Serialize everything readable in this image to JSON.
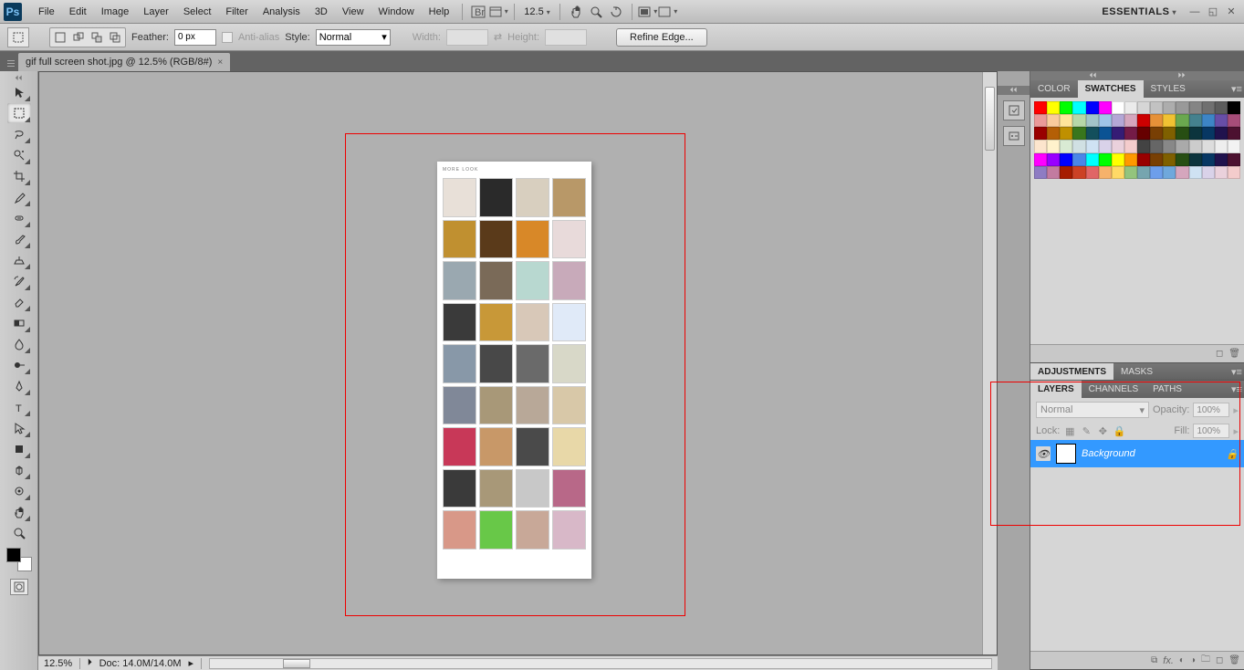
{
  "menubar": {
    "items": [
      "File",
      "Edit",
      "Image",
      "Layer",
      "Select",
      "Filter",
      "Analysis",
      "3D",
      "View",
      "Window",
      "Help"
    ],
    "zoom": "12.5",
    "workspace": "ESSENTIALS"
  },
  "optbar": {
    "feather_label": "Feather:",
    "feather_value": "0 px",
    "antialias": "Anti-alias",
    "style_label": "Style:",
    "style_value": "Normal",
    "width_label": "Width:",
    "height_label": "Height:",
    "refine": "Refine Edge..."
  },
  "doctab": {
    "title": "gif full screen shot.jpg @ 12.5% (RGB/8#)"
  },
  "canvas": {
    "title": "MORE LOOK",
    "foot": ""
  },
  "panels": {
    "color_tabs": [
      "COLOR",
      "SWATCHES",
      "STYLES"
    ],
    "adjust_tabs": [
      "ADJUSTMENTS",
      "MASKS"
    ],
    "layers_tabs": [
      "LAYERS",
      "CHANNELS",
      "PATHS"
    ],
    "layer_mode": "Normal",
    "opacity_label": "Opacity:",
    "opacity_value": "100%",
    "lock_label": "Lock:",
    "fill_label": "Fill:",
    "fill_value": "100%",
    "layer_name": "Background"
  },
  "status": {
    "zoom": "12.5%",
    "doc": "Doc: 14.0M/14.0M"
  },
  "swatches": [
    "#ff0000",
    "#ffff00",
    "#00ff00",
    "#00ffff",
    "#0000ff",
    "#ff00ff",
    "#ffffff",
    "#ebebeb",
    "#d6d6d6",
    "#c2c2c2",
    "#adadad",
    "#999999",
    "#858585",
    "#707070",
    "#5c5c5c",
    "#000000",
    "#ea9999",
    "#f9cb9c",
    "#ffe599",
    "#b6d7a8",
    "#a2c4c9",
    "#9fc5e8",
    "#b4a7d6",
    "#d5a6bd",
    "#cc0000",
    "#e69138",
    "#f1c232",
    "#6aa84f",
    "#45818e",
    "#3d85c6",
    "#674ea7",
    "#a64d79",
    "#990000",
    "#b45f06",
    "#bf9000",
    "#38761d",
    "#134f5c",
    "#0b5394",
    "#351c75",
    "#741b47",
    "#660000",
    "#783f04",
    "#7f6000",
    "#274e13",
    "#0c343d",
    "#073763",
    "#20124d",
    "#4c1130",
    "#fce5cd",
    "#fff2cc",
    "#d9ead3",
    "#d0e0e3",
    "#cfe2f3",
    "#d9d2e9",
    "#ead1dc",
    "#f4cccc",
    "#434343",
    "#666666",
    "#888888",
    "#aaaaaa",
    "#cccccc",
    "#dddddd",
    "#eeeeee",
    "#f3f3f3",
    "#ff00ff",
    "#9900ff",
    "#0000ff",
    "#4a86e8",
    "#00ffff",
    "#00ff00",
    "#ffff00",
    "#ff9900",
    "#980000",
    "#783f04",
    "#7f6000",
    "#274e13",
    "#0c343d",
    "#073763",
    "#20124d",
    "#4c1130",
    "#8e7cc3",
    "#c27ba0",
    "#a61c00",
    "#cc4125",
    "#e06666",
    "#f6b26b",
    "#ffd966",
    "#93c47d",
    "#76a5af",
    "#6d9eeb",
    "#6fa8dc",
    "#d5a6bd",
    "#cfe2f3",
    "#d9d2e9",
    "#ead1dc",
    "#f4cccc"
  ],
  "thumbs": [
    "#e8e0d8",
    "#2a2a2a",
    "#d8cfbf",
    "#b89868",
    "#c09030",
    "#5a3a1a",
    "#d88828",
    "#e8dada",
    "#9aa8b0",
    "#7a6a58",
    "#b8d8d0",
    "#c8aaba",
    "#3a3a3a",
    "#c89838",
    "#d8c8b8",
    "#e0eaf8",
    "#8898a8",
    "#484848",
    "#6a6a6a",
    "#d8d8c8",
    "#808898",
    "#a89878",
    "#b8a898",
    "#d8c8a8",
    "#c83858",
    "#c89868",
    "#4a4a4a",
    "#e8d8a8",
    "#3a3a3a",
    "#a89878",
    "#c8c8c8",
    "#b86888",
    "#d89888",
    "#68c848",
    "#c8a898",
    "#d8b8c8"
  ]
}
